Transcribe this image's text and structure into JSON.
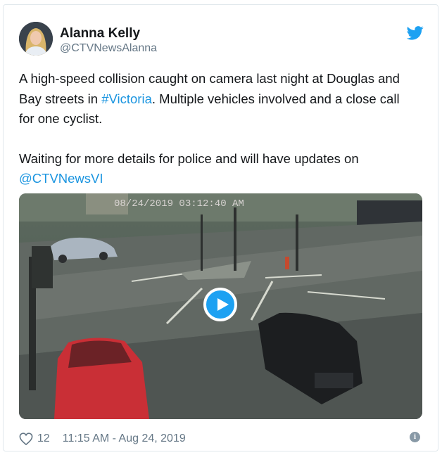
{
  "tweet": {
    "author_name": "Alanna Kelly",
    "author_handle": "@CTVNewsAlanna",
    "text_line1_before": "A high-speed collision caught on camera last night at Douglas and Bay streets in ",
    "hashtag": "#Victoria",
    "text_line1_after": ". Multiple vehicles involved and a close call for one cyclist.",
    "text_para2_before": "Waiting for more details for police and will have updates on ",
    "mention": "@CTVNewsVI",
    "video_overlay_timestamp": "08/24/2019 03:12:40 AM",
    "like_count": "12",
    "timestamp": "11:15 AM - Aug 24, 2019"
  },
  "icons": {
    "brand": "twitter-bird-icon",
    "like": "heart-icon",
    "info": "info-icon",
    "play": "play-icon"
  },
  "colors": {
    "link": "#1b95e0",
    "brand_blue": "#1da1f2",
    "secondary_text": "#657786"
  }
}
